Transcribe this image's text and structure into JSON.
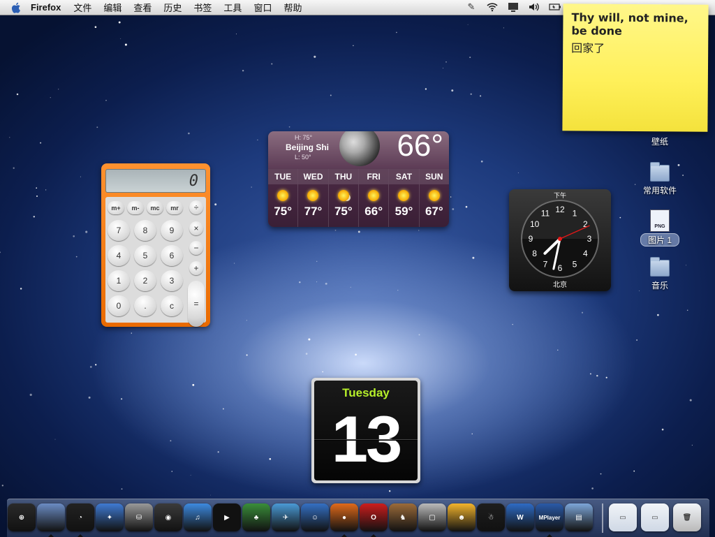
{
  "menubar": {
    "app_name": "Firefox",
    "items": [
      "文件",
      "编辑",
      "查看",
      "历史",
      "书签",
      "工具",
      "窗口",
      "帮助"
    ]
  },
  "sticky_note": {
    "line1": "Thy will, not mine, be done",
    "line2": "回家了"
  },
  "desktop_icons": [
    {
      "label": "壁纸"
    },
    {
      "label": "常用软件"
    },
    {
      "label": "图片 1",
      "file_badge": "PNG"
    },
    {
      "label": "音乐"
    }
  ],
  "calculator": {
    "display": "0",
    "memory_keys": [
      "m+",
      "m-",
      "mc",
      "mr"
    ],
    "ops": [
      "÷",
      "×",
      "−",
      "+",
      "="
    ],
    "rows": [
      [
        "7",
        "8",
        "9"
      ],
      [
        "4",
        "5",
        "6"
      ],
      [
        "1",
        "2",
        "3"
      ],
      [
        "0",
        ".",
        "c"
      ]
    ]
  },
  "weather": {
    "high": "H: 75°",
    "low": "L: 50°",
    "city": "Beijing Shi",
    "current_temp": "66°",
    "forecast": [
      {
        "day": "TUE",
        "temp": "75°"
      },
      {
        "day": "WED",
        "temp": "77°"
      },
      {
        "day": "THU",
        "temp": "75°"
      },
      {
        "day": "FRI",
        "temp": "66°"
      },
      {
        "day": "SAT",
        "temp": "59°"
      },
      {
        "day": "SUN",
        "temp": "67°"
      }
    ]
  },
  "clock": {
    "ampm": "下午",
    "city": "北京",
    "hour": 7,
    "minute": 32,
    "second": 11,
    "numbers": [
      "12",
      "1",
      "2",
      "3",
      "4",
      "5",
      "6",
      "7",
      "8",
      "9",
      "10",
      "11"
    ]
  },
  "date_widget": {
    "weekday": "Tuesday",
    "day": "13"
  },
  "dock": {
    "apps": [
      {
        "name": "dashboard",
        "color": "#2a2a2a",
        "glyph": "⊕"
      },
      {
        "name": "finder",
        "color": "#6b8cc4",
        "glyph": ""
      },
      {
        "name": "system-clock",
        "color": "#222",
        "glyph": "◔"
      },
      {
        "name": "safari",
        "color": "#3f7ad3",
        "glyph": "✦"
      },
      {
        "name": "disk-utility",
        "color": "#999",
        "glyph": "⛁"
      },
      {
        "name": "dvd-player",
        "color": "#3b3b3b",
        "glyph": "◉"
      },
      {
        "name": "itunes",
        "color": "#3d8ae0",
        "glyph": "♫"
      },
      {
        "name": "imovie",
        "color": "#111",
        "glyph": "▶"
      },
      {
        "name": "automator",
        "color": "#3a8e3a",
        "glyph": "♣"
      },
      {
        "name": "mail",
        "color": "#4a9ad6",
        "glyph": "✈"
      },
      {
        "name": "msn",
        "color": "#3470c4",
        "glyph": "☺"
      },
      {
        "name": "firefox",
        "color": "#e06a1a",
        "glyph": "●"
      },
      {
        "name": "opera",
        "color": "#cc1d1d",
        "glyph": "O"
      },
      {
        "name": "amule",
        "color": "#9b6b3a",
        "glyph": "♞"
      },
      {
        "name": "bootcamp",
        "color": "#bbb",
        "glyph": "▢"
      },
      {
        "name": "adium",
        "color": "#f3b42c",
        "glyph": "☻"
      },
      {
        "name": "qq",
        "color": "#1e1e1e",
        "glyph": "☃"
      },
      {
        "name": "word",
        "color": "#2e6bc5",
        "glyph": "W"
      },
      {
        "name": "mplayer",
        "color": "#2a5aa8",
        "glyph": "MPlayer"
      },
      {
        "name": "iphoto",
        "color": "#7da6d9",
        "glyph": "▤"
      }
    ],
    "right_items": [
      {
        "name": "minimized-window-1",
        "color": "#cfd8e5"
      },
      {
        "name": "minimized-window-2",
        "color": "#cfd8e5"
      },
      {
        "name": "trash",
        "color": "#b9b9b9"
      }
    ]
  }
}
